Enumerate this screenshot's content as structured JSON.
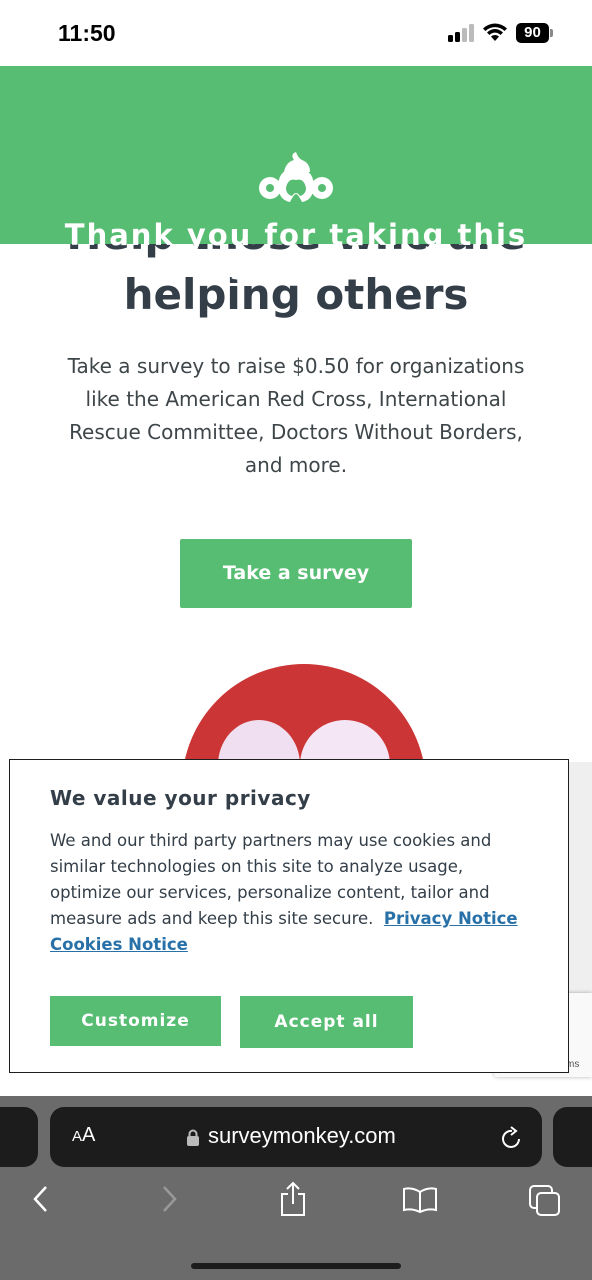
{
  "status_bar": {
    "time": "11:50",
    "battery": "90"
  },
  "banner": {
    "logo_icon": "surveymonkey-logo-icon",
    "text": "Thank you for taking this survey."
  },
  "page": {
    "headline_cut": "Help those who are",
    "headline": "helping others",
    "description": "Take a survey to raise $0.50 for organizations like the American Red Cross, International Rescue Committee, Doctors Without Borders, and more.",
    "cta_label": "Take a survey"
  },
  "cookie_dialog": {
    "title": "We value your privacy",
    "body": "We and our third party partners may use cookies and similar technologies on this site to analyze usage, optimize our services, personalize content, tailor and measure ads and keep this site secure.",
    "privacy_link": "Privacy Notice",
    "cookies_link": "Cookies Notice",
    "customize_label": "Customize",
    "accept_label": "Accept all"
  },
  "recaptcha": {
    "fragment": "ms"
  },
  "browser": {
    "text_size_label_small": "A",
    "text_size_label_large": "A",
    "url": "surveymonkey.com"
  },
  "colors": {
    "brand_green": "#57bd73",
    "link_blue": "#2871a8",
    "text_dark": "#333e48"
  }
}
